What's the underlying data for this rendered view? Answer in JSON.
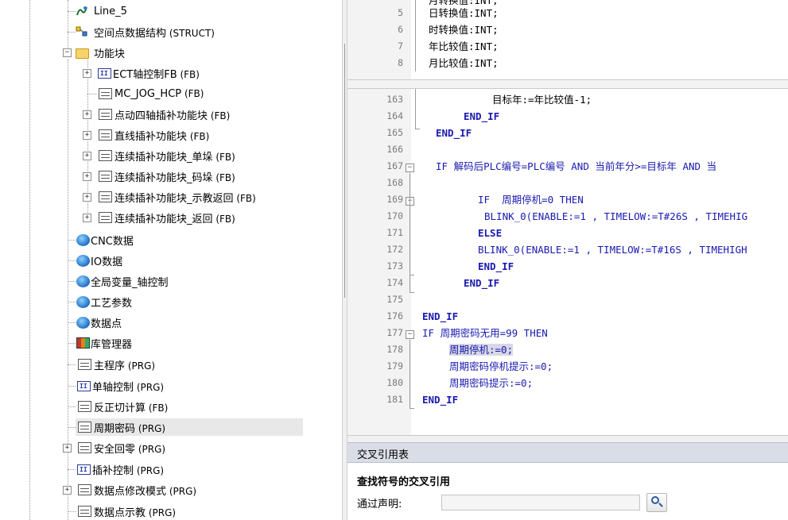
{
  "tree": {
    "items": [
      {
        "label": "Line_5",
        "suffix": "",
        "icon": "line-icon"
      },
      {
        "label": "空间点数据结构",
        "suffix": " (STRUCT)",
        "icon": "struct-icon"
      },
      {
        "label": "功能块",
        "suffix": "",
        "icon": "folder-icon"
      },
      {
        "label": "ECT轴控制FB",
        "suffix": " (FB)",
        "icon": "fb-icon"
      },
      {
        "label": "MC_JOG_HCP",
        "suffix": " (FB)",
        "icon": "document-icon"
      },
      {
        "label": "点动四轴插补功能块",
        "suffix": " (FB)",
        "icon": "document-icon"
      },
      {
        "label": "直线插补功能块",
        "suffix": " (FB)",
        "icon": "document-icon"
      },
      {
        "label": "连续插补功能块_单垛",
        "suffix": " (FB)",
        "icon": "document-icon"
      },
      {
        "label": "连续插补功能块_码垛",
        "suffix": " (FB)",
        "icon": "document-icon"
      },
      {
        "label": "连续插补功能块_示教返回",
        "suffix": " (FB)",
        "icon": "document-icon"
      },
      {
        "label": "连续插补功能块_返回",
        "suffix": " (FB)",
        "icon": "document-icon"
      },
      {
        "label": "CNC数据",
        "suffix": "",
        "icon": "globe-icon"
      },
      {
        "label": "IO数据",
        "suffix": "",
        "icon": "globe-icon"
      },
      {
        "label": "全局变量_轴控制",
        "suffix": "",
        "icon": "globe-icon"
      },
      {
        "label": "工艺参数",
        "suffix": "",
        "icon": "globe-icon"
      },
      {
        "label": "数据点",
        "suffix": "",
        "icon": "globe-icon"
      },
      {
        "label": "库管理器",
        "suffix": "",
        "icon": "library-icon"
      },
      {
        "label": "主程序",
        "suffix": " (PRG)",
        "icon": "document-icon"
      },
      {
        "label": "单轴控制",
        "suffix": " (PRG)",
        "icon": "fb-icon"
      },
      {
        "label": "反正切计算",
        "suffix": " (FB)",
        "icon": "document-icon"
      },
      {
        "label": "周期密码",
        "suffix": " (PRG)",
        "icon": "document-icon"
      },
      {
        "label": "安全回零",
        "suffix": " (PRG)",
        "icon": "document-icon"
      },
      {
        "label": "插补控制",
        "suffix": " (PRG)",
        "icon": "fb-icon"
      },
      {
        "label": "数据点修改模式",
        "suffix": " (PRG)",
        "icon": "document-icon"
      },
      {
        "label": "数据点示教",
        "suffix": " (PRG)",
        "icon": "document-icon"
      }
    ],
    "expander_collapsed": "+",
    "expander_expanded": "−"
  },
  "declarations": {
    "lines": [
      {
        "num": "",
        "text": "月转换值:INT;"
      },
      {
        "num": "5",
        "text": "日转换值:INT;"
      },
      {
        "num": "6",
        "text": "时转换值:INT;"
      },
      {
        "num": "7",
        "text": "年比较值:INT;"
      },
      {
        "num": "8",
        "text": "月比较值:INT;"
      }
    ]
  },
  "implementation": {
    "line_numbers": [
      "163",
      "164",
      "165",
      "166",
      "167",
      "168",
      "169",
      "170",
      "171",
      "172",
      "173",
      "174",
      "175",
      "176",
      "177",
      "178",
      "179",
      "180",
      "181"
    ],
    "fold_open": "−",
    "lines": [
      {
        "text": "目标年:=年比较值-1;"
      },
      {
        "text": "END_IF"
      },
      {
        "text": "END_IF"
      },
      {
        "text": ""
      },
      {
        "text": "IF 解码后PLC编号=PLC编号 AND 当前年分>=目标年 AND 当"
      },
      {
        "text": ""
      },
      {
        "text": "IF  周期停机=0 THEN"
      },
      {
        "text": "BLINK_0(ENABLE:=1 , TIMELOW:=T#26S , TIMEHIG"
      },
      {
        "text": "ELSE"
      },
      {
        "text": "BLINK_0(ENABLE:=1 , TIMELOW:=T#16S , TIMEHIGH"
      },
      {
        "text": "END_IF"
      },
      {
        "text": "END_IF"
      },
      {
        "text": ""
      },
      {
        "text": "END_IF"
      },
      {
        "text": "IF 周期密码无用=99 THEN"
      },
      {
        "text": "周期停机:=0;"
      },
      {
        "text": "周期密码停机提示:=0;"
      },
      {
        "text": "周期密码提示:=0;"
      },
      {
        "text": "END_IF"
      }
    ]
  },
  "xref": {
    "title": "交叉引用表",
    "heading": "查找符号的交叉引用",
    "label": "通过声明:",
    "input_value": "",
    "search_icon": "search-icon"
  }
}
